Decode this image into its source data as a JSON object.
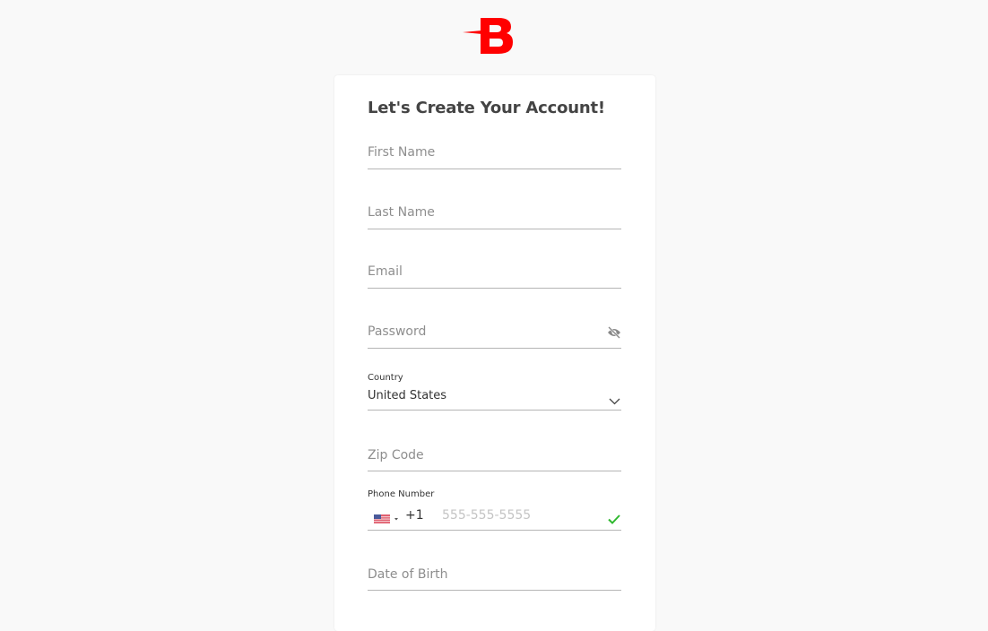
{
  "brand": {
    "logo_letter": "B",
    "color": "#ff0000"
  },
  "form": {
    "title": "Let's Create Your Account!",
    "first_name": {
      "placeholder": "First Name",
      "value": ""
    },
    "last_name": {
      "placeholder": "Last Name",
      "value": ""
    },
    "email": {
      "placeholder": "Email",
      "value": ""
    },
    "password": {
      "placeholder": "Password",
      "value": "",
      "toggle_icon": "eye-off-icon"
    },
    "country": {
      "label": "Country",
      "selected": "United States",
      "icon": "chevron-down-icon"
    },
    "zip": {
      "placeholder": "Zip Code",
      "value": ""
    },
    "phone": {
      "label": "Phone Number",
      "flag": "us-flag-icon",
      "dial_code": "+1",
      "placeholder": "555-555-5555",
      "status_icon": "checkmark-icon",
      "status_color": "#2eb82e"
    },
    "dob": {
      "placeholder": "Date of Birth",
      "value": ""
    }
  }
}
